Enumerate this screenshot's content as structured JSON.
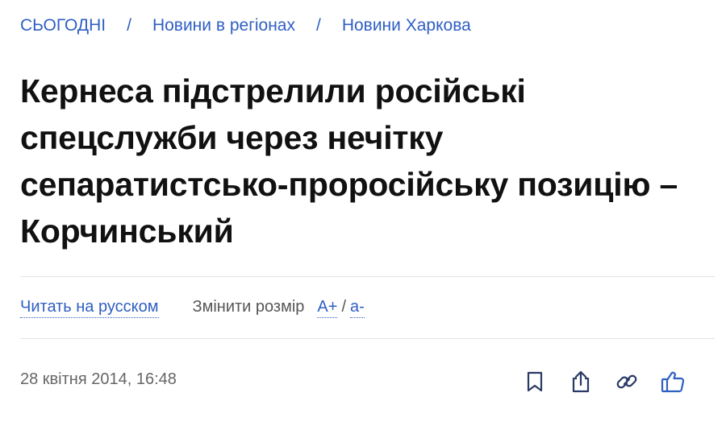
{
  "breadcrumb": {
    "items": [
      "СЬОГОДНІ",
      "Новини в регіонах",
      "Новини Харкова"
    ],
    "separator": "/"
  },
  "article": {
    "title": "Кернеса підстрелили російські спецслужби через нечітку сепаратистсько-проросійську позицію – Корчинський",
    "date": "28 квітня 2014, 16:48"
  },
  "tools": {
    "read_in_russian": "Читать на русском",
    "resize_label": "Змінити розмір",
    "increase": "А+",
    "slash": "/",
    "decrease": "а-"
  },
  "actions": {
    "icons": [
      "bookmark-icon",
      "share-icon",
      "link-icon",
      "like-icon"
    ]
  },
  "colors": {
    "accent": "#2f5fc2",
    "text": "#111111",
    "muted": "#666666",
    "divider": "#e3e3e3"
  }
}
